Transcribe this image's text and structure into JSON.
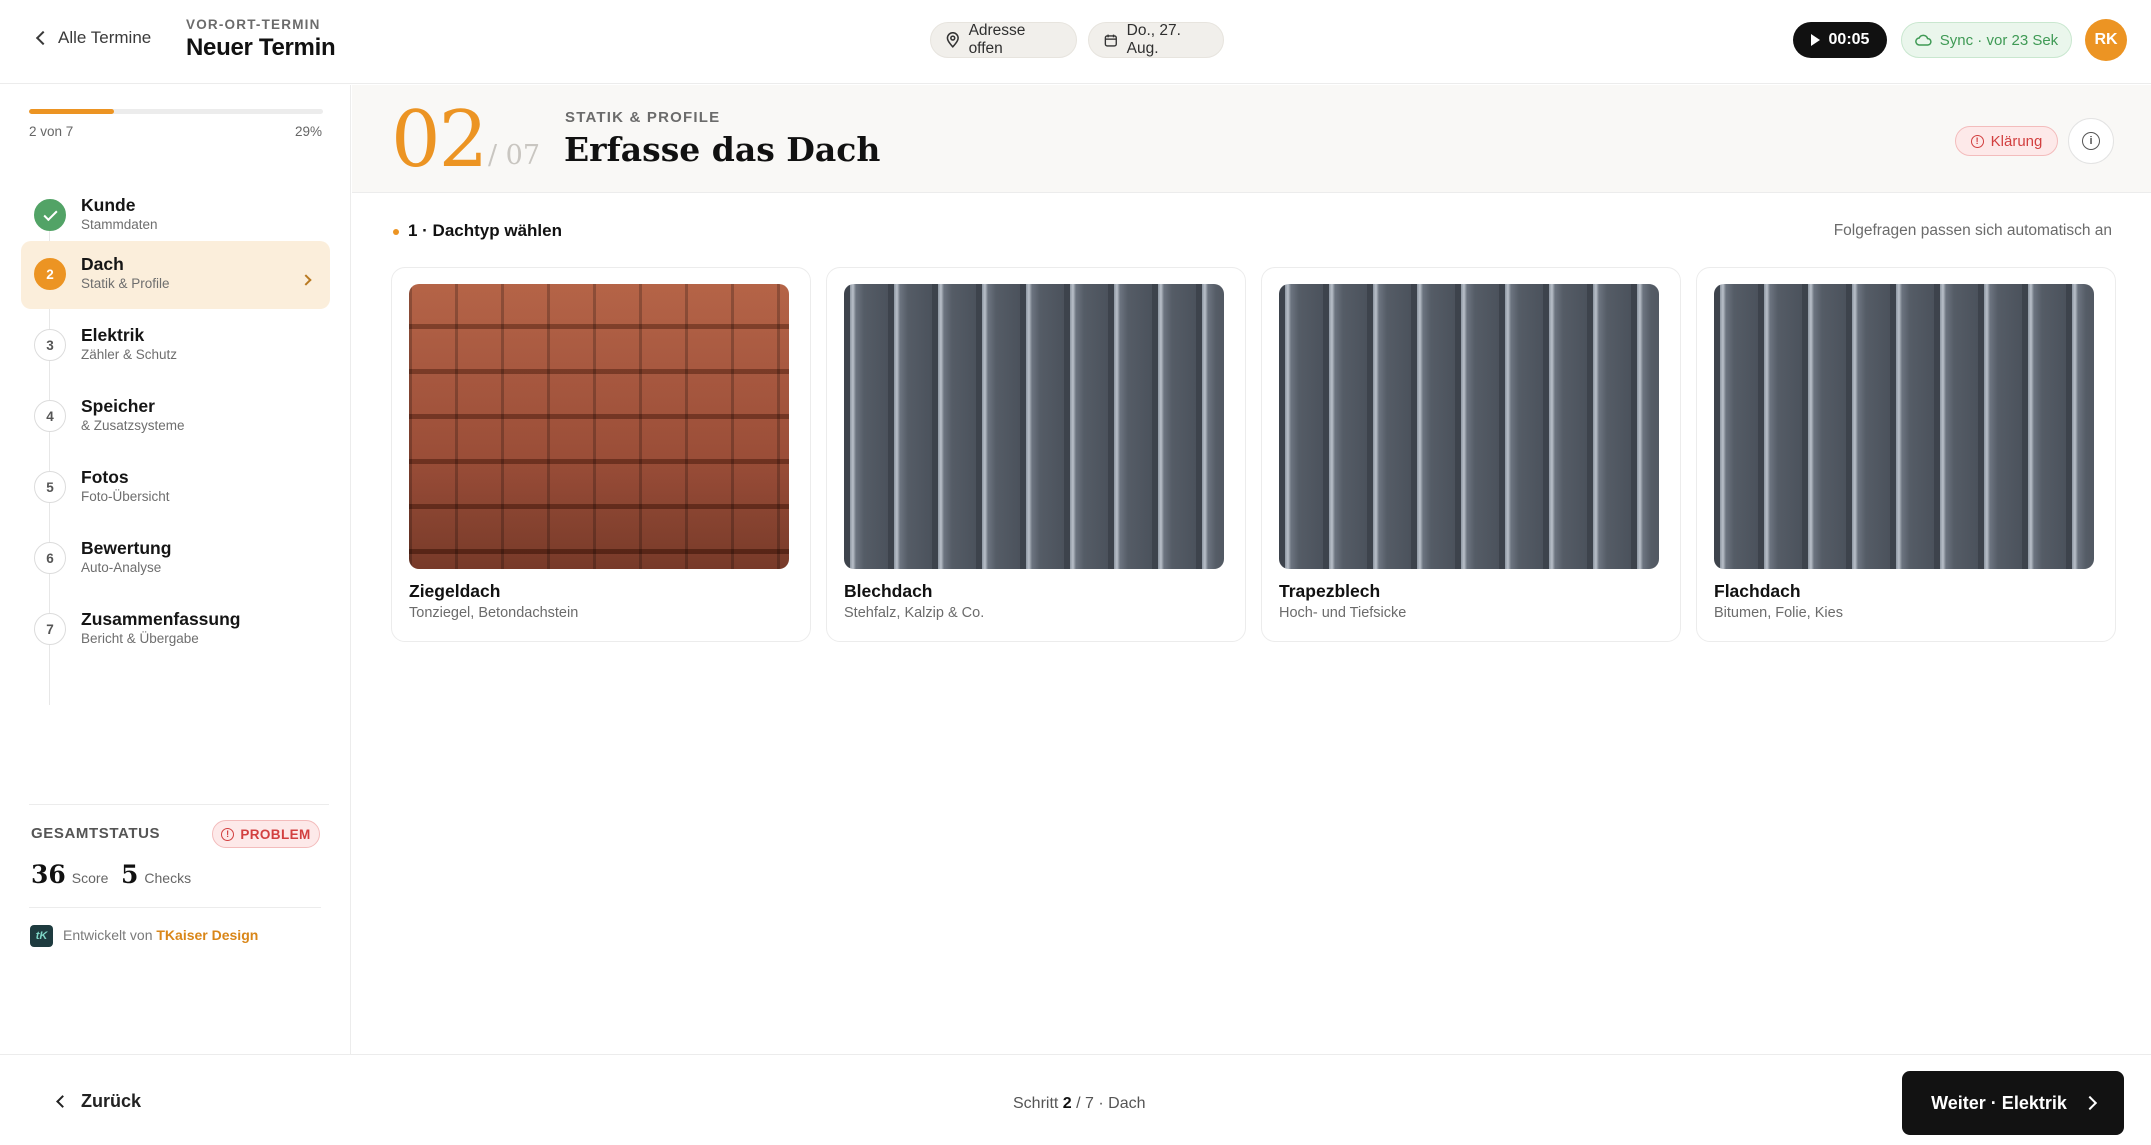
{
  "header": {
    "back_label": "Alle Termine",
    "eyebrow": "VOR-ORT-TERMIN",
    "title": "Neuer Termin",
    "address_pill": "Adresse offen",
    "date_pill": "Do., 27. Aug.",
    "timer": "00:05",
    "sync": "Sync · vor 23 Sek",
    "avatar_initials": "RK"
  },
  "progress": {
    "left": "2 von 7",
    "right": "29%",
    "fraction": 0.29
  },
  "steps": [
    {
      "num": "1",
      "label": "Kunde",
      "sub": "Stammdaten",
      "state": "done"
    },
    {
      "num": "2",
      "label": "Dach",
      "sub": "Statik & Profile",
      "state": "current"
    },
    {
      "num": "3",
      "label": "Elektrik",
      "sub": "Zähler & Schutz",
      "state": "todo"
    },
    {
      "num": "4",
      "label": "Speicher",
      "sub": "& Zusatzsysteme",
      "state": "todo"
    },
    {
      "num": "5",
      "label": "Fotos",
      "sub": "Foto-Übersicht",
      "state": "todo"
    },
    {
      "num": "6",
      "label": "Bewertung",
      "sub": "Auto-Analyse",
      "state": "todo"
    },
    {
      "num": "7",
      "label": "Zusammenfassung",
      "sub": "Bericht & Übergabe",
      "state": "todo"
    }
  ],
  "status": {
    "label": "GESAMTSTATUS",
    "badge": "PROBLEM",
    "score_value": "36",
    "score_label": "Score",
    "checks_value": "5",
    "checks_label": "Checks"
  },
  "developer": {
    "prefix": "Entwickelt von",
    "brand": "TKaiser Design",
    "logo": "tK"
  },
  "main": {
    "step_number": "02",
    "step_total": "/ 07",
    "eyebrow": "STATIK & PROFILE",
    "title": "Erfasse das Dach",
    "klaerung": "Klärung",
    "section_title": "1 · Dachtyp wählen",
    "section_hint": "Folgefragen passen sich automatisch an"
  },
  "cards": [
    {
      "title": "Ziegeldach",
      "sub": "Tonziegel, Betondachstein"
    },
    {
      "title": "Blechdach",
      "sub": "Stehfalz, Kalzip & Co."
    },
    {
      "title": "Trapezblech",
      "sub": "Hoch- und Tiefsicke"
    },
    {
      "title": "Flachdach",
      "sub": "Bitumen, Folie, Kies"
    }
  ],
  "footer": {
    "back_label": "Zurück",
    "center_prefix": "Schritt",
    "center_current": "2",
    "center_suffix": "/ 7 · Dach",
    "next_label": "Weiter · Elektrik"
  },
  "colors": {
    "accent": "#ec9423",
    "success": "#52a366",
    "danger": "#d23f3f"
  }
}
